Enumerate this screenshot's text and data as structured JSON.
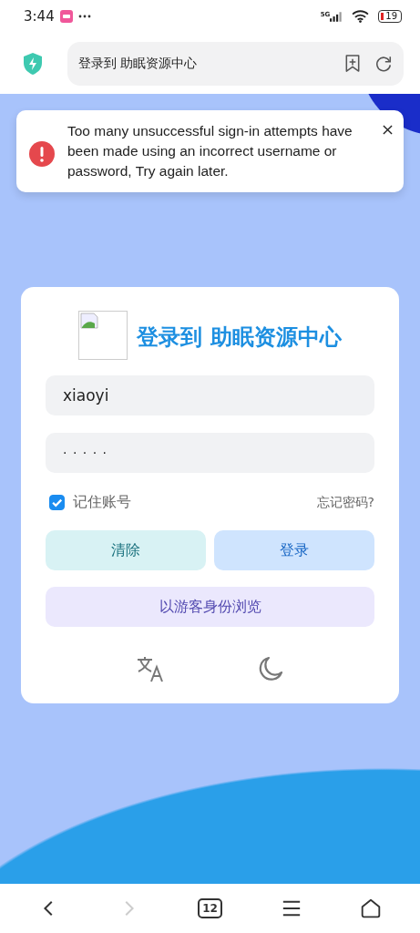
{
  "status_bar": {
    "time": "3:44",
    "network": "5G",
    "battery": "19"
  },
  "browser": {
    "page_title": "登录到 助眠资源中心",
    "tab_count": "12",
    "back_disabled": false,
    "forward_disabled": true
  },
  "alert": {
    "message": "Too many unsuccessful sign-in attempts have been made using an incorrect username or password, Try again later."
  },
  "login": {
    "title": "登录到 助眠资源中心",
    "username": "xiaoyi",
    "password_mask": "· · · · ·",
    "remember": {
      "label": "记住账号",
      "checked": true
    },
    "forgot": "忘记密码?",
    "buttons": [
      {
        "label": "清除",
        "kind": "clear"
      },
      {
        "label": "登录",
        "kind": "submit"
      }
    ],
    "guest": "以游客身份浏览"
  }
}
